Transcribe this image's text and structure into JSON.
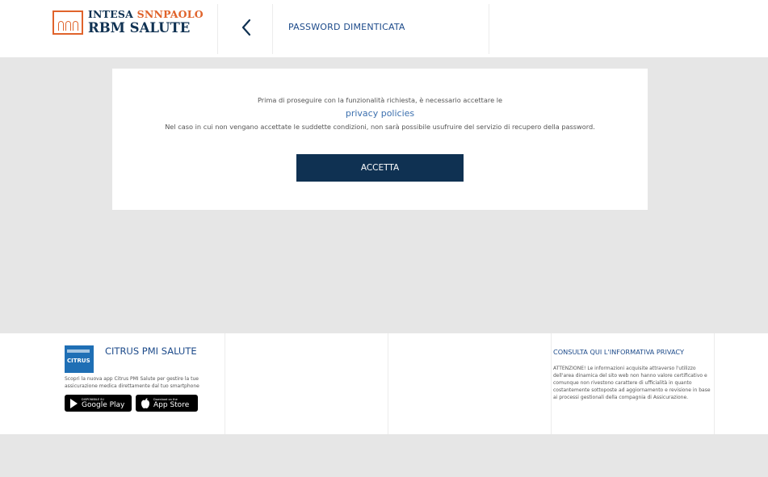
{
  "header": {
    "logo": {
      "line1_a": "INTESA ",
      "line1_b": "SNNPAOLO",
      "line2": "RBM SALUTE"
    },
    "title": "PASSWORD DIMENTICATA"
  },
  "card": {
    "message_line1": "Prima di proseguire con la funzionalità richiesta, è necessario accettare le",
    "privacy_link": "privacy policies",
    "message_line2": "Nel caso in cui non vengano accettate le suddette condizioni, non sarà possibile usufruire del servizio di recupero della password.",
    "accept_label": "ACCETTA"
  },
  "footer": {
    "citrus": {
      "logo_text": "CITRUS",
      "title": "CITRUS PMI SALUTE",
      "description": "Scopri la nuova app Citrus PMI Salute per gestire la tue assicurazione medica direttamente dal tuo smartphone",
      "google_play": {
        "small": "DISPONIBILE SU",
        "big": "Google Play"
      },
      "app_store": {
        "small": "Download on the",
        "big": "App Store"
      }
    },
    "privacy": {
      "title": "CONSULTA QUI  L'INFORMATIVA PRIVACY",
      "text": "ATTENZIONE! Le informazioni acquisite attraverso l'utilizzo dell'area dinamica del sito web non hanno valore certificativo e comunque non rivestono carattere di ufficialità in quanto costantemente sottoposte ad aggiornamento e revisione in base ai processi gestionali della compagnia di Assicurazione."
    }
  },
  "colors": {
    "navy": "#0f3152",
    "orange": "#e0632b",
    "link": "#3b6fae",
    "background": "#e6e6e6"
  }
}
